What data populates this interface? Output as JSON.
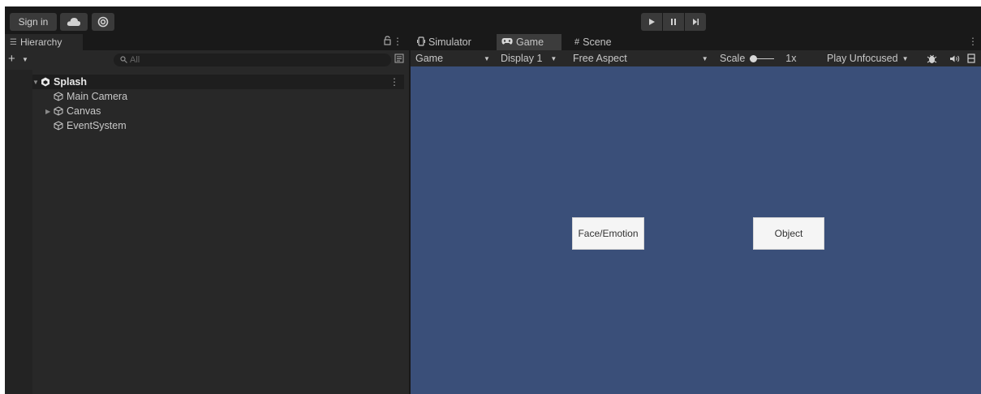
{
  "toolbar": {
    "sign_in_label": "Sign in",
    "cloud_icon": "cloud-icon",
    "collab_icon": "collab-icon",
    "play_controls": [
      "play-icon",
      "pause-icon",
      "step-icon"
    ]
  },
  "hierarchy": {
    "tab_label": "Hierarchy",
    "search_placeholder": "All",
    "scene": {
      "name": "Splash",
      "children": [
        {
          "name": "Main Camera",
          "expandable": false
        },
        {
          "name": "Canvas",
          "expandable": true
        },
        {
          "name": "EventSystem",
          "expandable": false
        }
      ]
    }
  },
  "game_view": {
    "tabs": [
      {
        "label": "Simulator",
        "icon": "simulator-icon",
        "active": false
      },
      {
        "label": "Game",
        "icon": "gamepad-icon",
        "active": true
      },
      {
        "label": "Scene",
        "icon": "grid-icon",
        "active": false
      }
    ],
    "controls": {
      "view_mode": "Game",
      "display": "Display 1",
      "aspect": "Free Aspect",
      "scale_label": "Scale",
      "scale_value": "1x",
      "play_mode": "Play Unfocused"
    },
    "buttons": {
      "face_emotion": "Face/Emotion",
      "object": "Object"
    }
  },
  "colors": {
    "editor_bg": "#191919",
    "panel_bg": "#282828",
    "viewport_bg": "#3a4f79",
    "button_bg": "#f5f5f5"
  }
}
